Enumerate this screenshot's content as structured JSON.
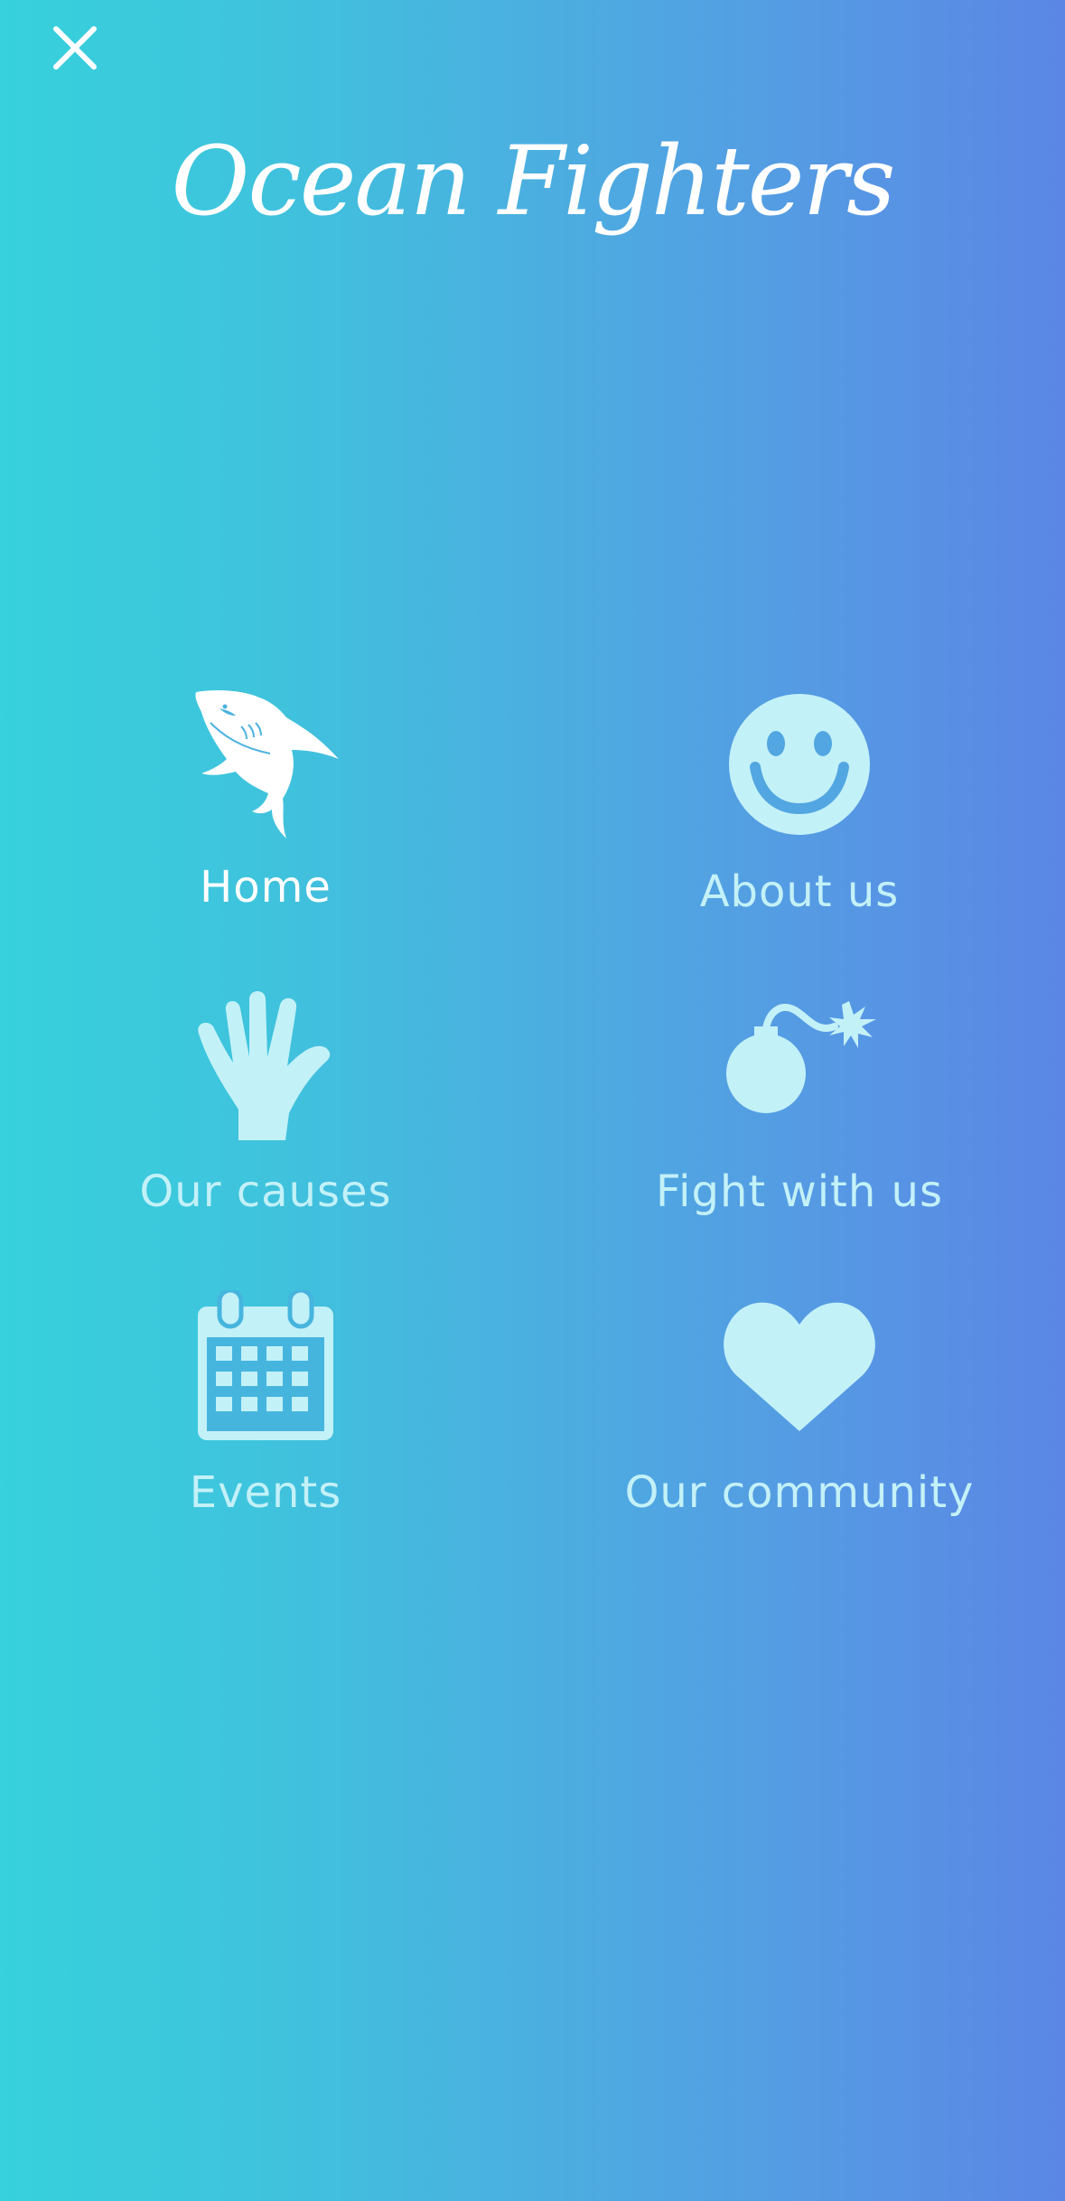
{
  "header": {
    "close_label": "close"
  },
  "title": "Ocean Fighters",
  "menu": [
    {
      "label": "Home",
      "icon": "shark-icon"
    },
    {
      "label": "About us",
      "icon": "smiley-icon"
    },
    {
      "label": "Our causes",
      "icon": "hand-icon"
    },
    {
      "label": "Fight with us",
      "icon": "bomb-icon"
    },
    {
      "label": "Events",
      "icon": "calendar-icon"
    },
    {
      "label": "Our community",
      "icon": "heart-icon"
    }
  ],
  "colors": {
    "gradient_start": "#36d1dc",
    "gradient_end": "#5b86e5",
    "icon": "#c3f1f8",
    "active": "#ffffff"
  }
}
